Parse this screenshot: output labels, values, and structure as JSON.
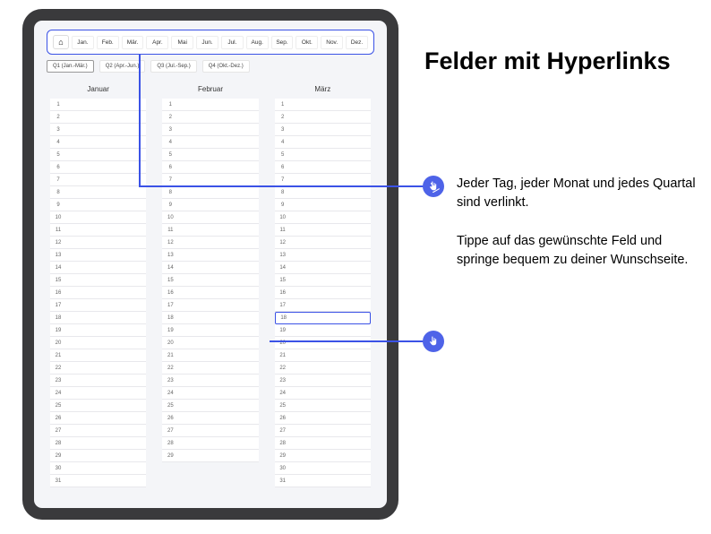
{
  "side": {
    "title": "Felder mit Hyperlinks",
    "p1": "Jeder Tag, jeder Monat und jedes Quartal sind verlinkt.",
    "p2": "Tippe auf das gewünschte Feld und springe bequem zu deiner Wunschseite."
  },
  "nav": {
    "home": "⌂",
    "months": [
      "Jan.",
      "Feb.",
      "Mär.",
      "Apr.",
      "Mai",
      "Jun.",
      "Jul.",
      "Aug.",
      "Sep.",
      "Okt.",
      "Nov.",
      "Dez."
    ],
    "quarters": [
      "Q1 (Jan.-Mär.)",
      "Q2 (Apr.-Jun.)",
      "Q3 (Jul.-Sep.)",
      "Q4 (Okt.-Dez.)"
    ]
  },
  "columns": {
    "m1": "Januar",
    "m2": "Februar",
    "m3": "März"
  },
  "highlighted_day": 18,
  "colors": {
    "accent": "#3b52e6"
  }
}
